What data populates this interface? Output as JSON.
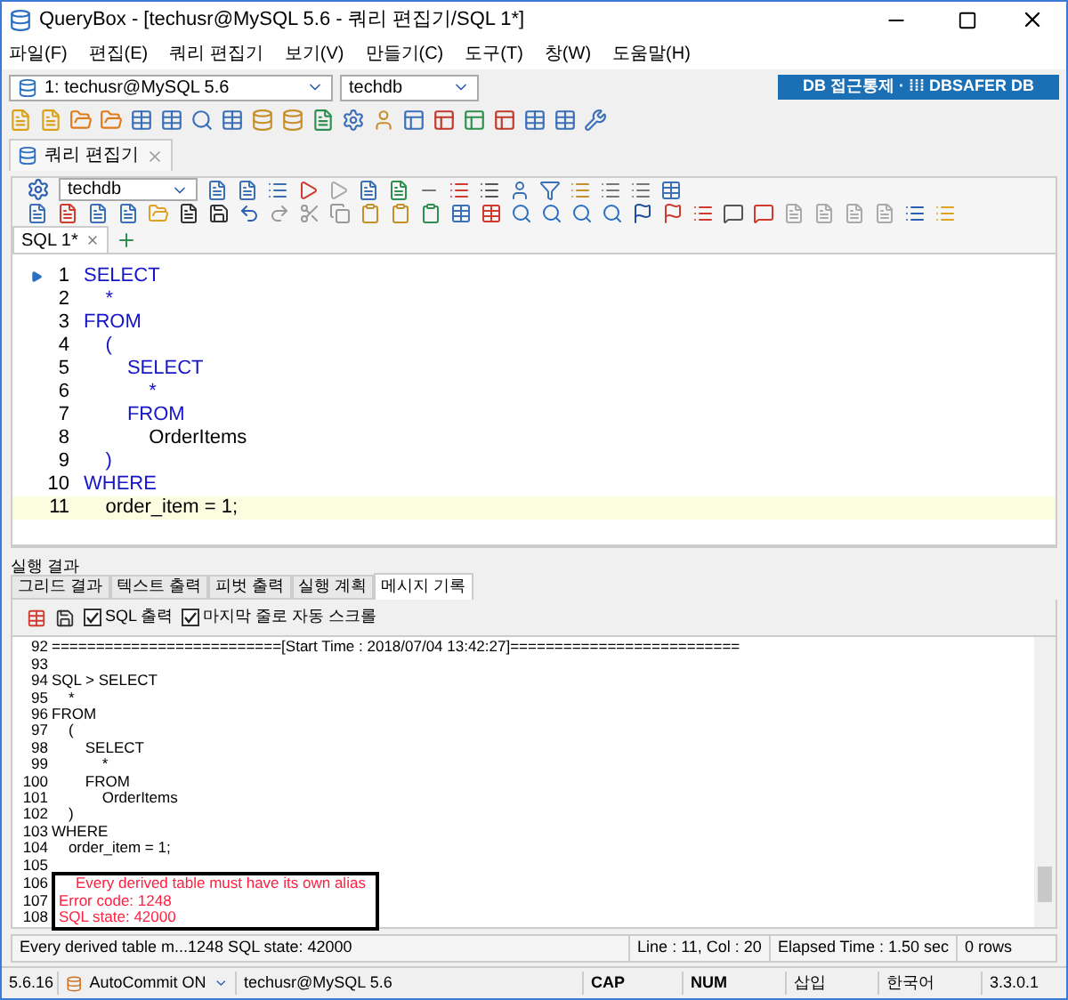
{
  "window": {
    "title": "QueryBox - [techusr@MySQL 5.6 - 쿼리 편집기/SQL 1*]"
  },
  "menu": [
    "파일(F)",
    "편집(E)",
    "쿼리 편집기",
    "보기(V)",
    "만들기(C)",
    "도구(T)",
    "창(W)",
    "도움말(H)"
  ],
  "connection": {
    "value": "1: techusr@MySQL 5.6",
    "database": "techdb"
  },
  "banner": "DB 접근통제 · ⁞⁞⁞ DBSAFER DB",
  "doc_tab": {
    "label": "쿼리 편집기"
  },
  "editor_db": "techdb",
  "editor_tabs": [
    {
      "label": "SQL 1*",
      "selected": true
    }
  ],
  "code": [
    {
      "num": "1",
      "text": "SELECT",
      "kind": "keyword"
    },
    {
      "num": "2",
      "text": "    *",
      "kind": "keyword"
    },
    {
      "num": "3",
      "text": "FROM",
      "kind": "keyword"
    },
    {
      "num": "4",
      "text": "    (",
      "kind": "keyword"
    },
    {
      "num": "5",
      "text": "        SELECT",
      "kind": "keyword"
    },
    {
      "num": "6",
      "text": "            *",
      "kind": "keyword"
    },
    {
      "num": "7",
      "text": "        FROM",
      "kind": "keyword"
    },
    {
      "num": "8",
      "text": "            OrderItems",
      "kind": "plain"
    },
    {
      "num": "9",
      "text": "    )",
      "kind": "keyword"
    },
    {
      "num": "10",
      "text": "WHERE",
      "kind": "keyword"
    },
    {
      "num": "11",
      "text": "    order_item = 1;",
      "kind": "current"
    }
  ],
  "results": {
    "title": "실행 결과",
    "tabs": [
      {
        "label": "그리드 결과",
        "selected": false
      },
      {
        "label": "텍스트 출력",
        "selected": false
      },
      {
        "label": "피벗 출력",
        "selected": false
      },
      {
        "label": "실행 계획",
        "selected": false
      },
      {
        "label": "메시지 기록",
        "selected": true
      }
    ],
    "options": [
      {
        "label": "SQL 출력",
        "checked": true
      },
      {
        "label": "마지막 줄로 자동 스크롤",
        "checked": true
      }
    ],
    "log": [
      {
        "num": "92",
        "text": "==========================[Start Time : 2018/07/04 13:42:27]==========================",
        "kind": "plain"
      },
      {
        "num": "93"
      },
      {
        "num": "94",
        "text": "SQL > SELECT",
        "kind": "plain"
      },
      {
        "num": "95",
        "text": "    *",
        "kind": "plain"
      },
      {
        "num": "96",
        "text": "FROM",
        "kind": "plain"
      },
      {
        "num": "97",
        "text": "    (",
        "kind": "plain"
      },
      {
        "num": "98",
        "text": "        SELECT",
        "kind": "plain"
      },
      {
        "num": "99",
        "text": "            *",
        "kind": "plain"
      },
      {
        "num": "100",
        "text": "        FROM",
        "kind": "plain"
      },
      {
        "num": "101",
        "text": "            OrderItems",
        "kind": "plain"
      },
      {
        "num": "102",
        "text": "    )",
        "kind": "plain"
      },
      {
        "num": "103",
        "text": "WHERE",
        "kind": "plain"
      },
      {
        "num": "104",
        "text": "    order_item = 1;",
        "kind": "plain"
      },
      {
        "num": "105"
      },
      {
        "num": "106",
        "text": "    Every derived table must have its own alias",
        "kind": "error"
      },
      {
        "num": "107",
        "text": "Error code: 1248",
        "kind": "error"
      },
      {
        "num": "108",
        "text": "SQL state: 42000",
        "kind": "error"
      }
    ]
  },
  "status_bar": {
    "message": "Every derived table m...1248 SQL state: 42000",
    "position": "Line : 11, Col : 20",
    "elapsed": "Elapsed Time : 1.50 sec",
    "rows": "0 rows"
  },
  "bottom_bar": {
    "version": "5.6.16",
    "autocommit": "AutoCommit ON",
    "user": "techusr@MySQL 5.6",
    "cap": "CAP",
    "num": "NUM",
    "mode": "삽입",
    "ime": "한국어",
    "app_version": "3.3.0.1"
  }
}
